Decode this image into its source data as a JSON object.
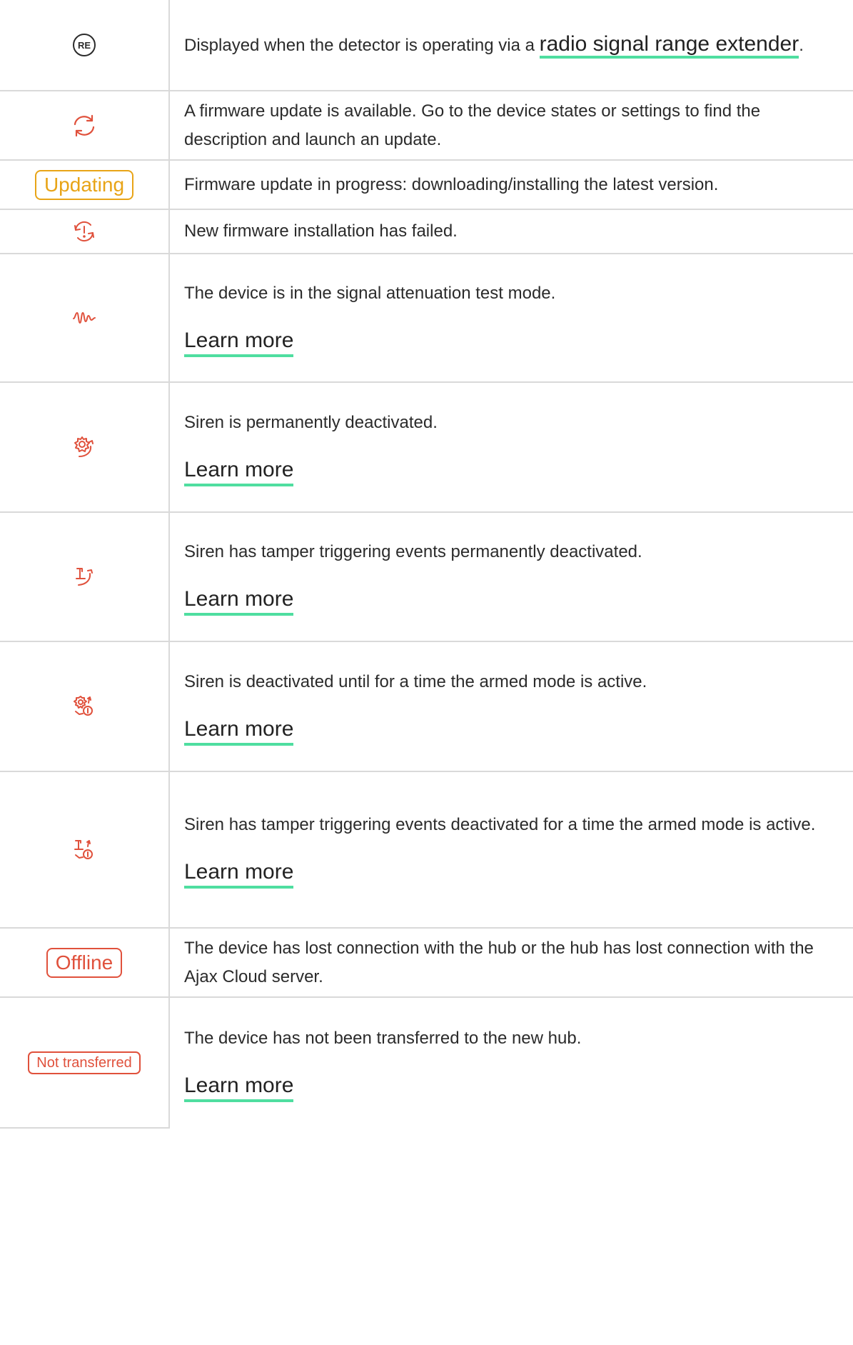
{
  "colors": {
    "accent_red": "#e0513c",
    "accent_amber": "#e8a417",
    "link_underline": "#4fdea0",
    "border": "#d9d9d9"
  },
  "rows": [
    {
      "icon": "re-circle-icon",
      "text_before": "Displayed when the detector is operating via a ",
      "link": "radio signal range extender",
      "text_after": "."
    },
    {
      "icon": "refresh-update-icon",
      "text": "A firmware update is available. Go to the device states or settings to find the description and launch an update."
    },
    {
      "badge": "Updating",
      "text": "Firmware update in progress: downloading/installing the latest version."
    },
    {
      "icon": "update-failed-icon",
      "text": "New firmware installation has failed."
    },
    {
      "icon": "signal-attenuation-wave-icon",
      "text": "The device is in the signal attenuation test mode.",
      "link": "Learn more"
    },
    {
      "icon": "siren-deactivated-icon",
      "text": "Siren is permanently deactivated.",
      "link": "Learn more"
    },
    {
      "icon": "tamper-deactivated-icon",
      "text": "Siren has tamper triggering events permanently deactivated.",
      "link": "Learn more"
    },
    {
      "icon": "siren-deactivated-timer-icon",
      "text": "Siren is deactivated until for a time the armed mode is active.",
      "link": "Learn more"
    },
    {
      "icon": "tamper-deactivated-timer-icon",
      "text": "Siren has tamper triggering events deactivated for a time the armed mode is active.",
      "link": "Learn more"
    },
    {
      "badge": "Offline",
      "text": "The device has lost connection with the hub or the hub has lost connection with the Ajax Cloud server."
    },
    {
      "badge": "Not transferred",
      "text": "The device has not been transferred to the new hub.",
      "link": "Learn more"
    }
  ]
}
